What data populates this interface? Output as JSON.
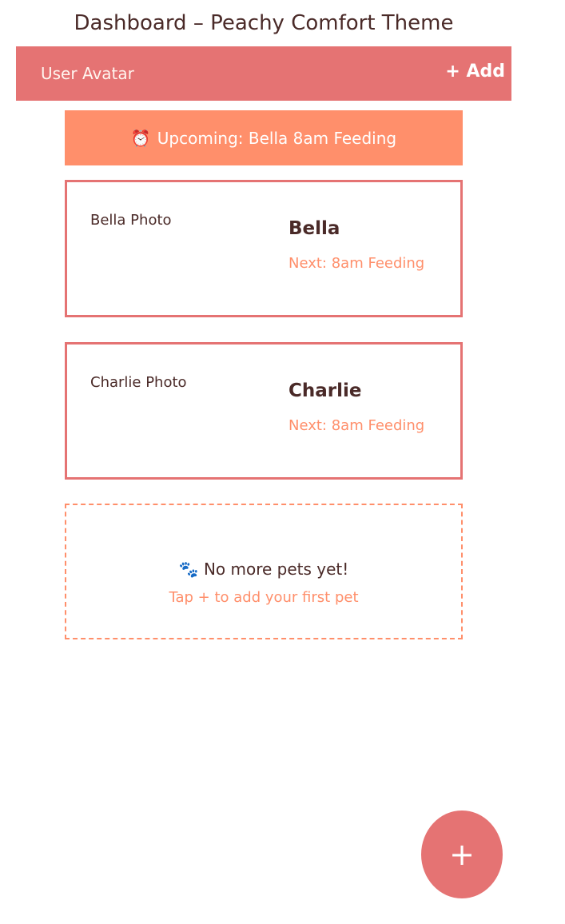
{
  "page": {
    "title": "Dashboard – Peachy Comfort Theme"
  },
  "topbar": {
    "avatar_label": "User Avatar",
    "add_label": "+ Add"
  },
  "banner": {
    "icon": "⏰",
    "text": "Upcoming: Bella 8am Feeding"
  },
  "pets": [
    {
      "photo_label": "Bella Photo",
      "name": "Bella",
      "next": "Next: 8am Feeding"
    },
    {
      "photo_label": "Charlie Photo",
      "name": "Charlie",
      "next": "Next: 8am Feeding"
    }
  ],
  "empty_state": {
    "icon": "🐾",
    "title": "No more pets yet!",
    "subtitle": "Tap + to add your first pet"
  },
  "fab": {
    "label": "+"
  },
  "colors": {
    "primary": "#e57373",
    "accent": "#ff8f6b",
    "text": "#4a2a28"
  }
}
